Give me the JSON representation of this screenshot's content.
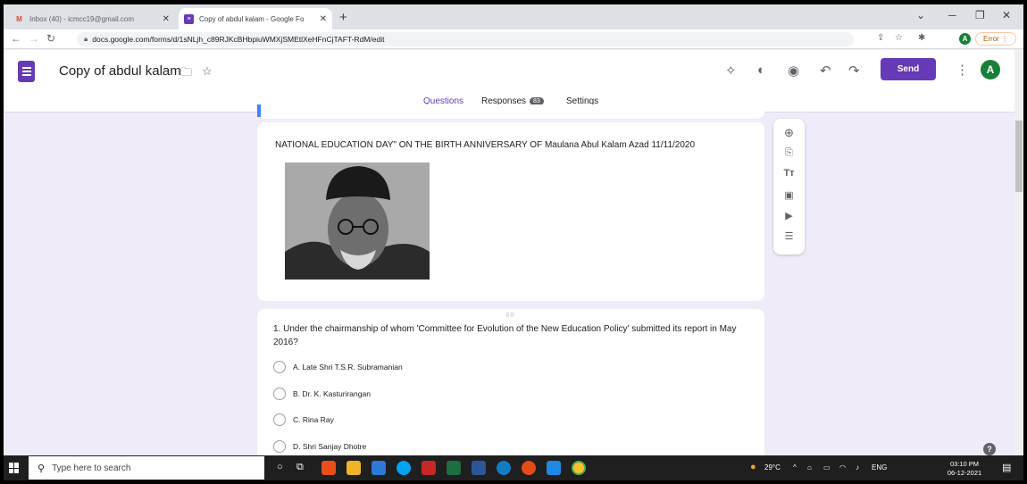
{
  "browser": {
    "tabs": [
      {
        "title": "Inbox (40) - icmcc19@gmail.com",
        "icon": "gmail-icon"
      },
      {
        "title": "Copy of abdul kalam - Google Fo",
        "icon": "forms-icon"
      }
    ],
    "url": "docs.google.com/forms/d/1sNLjh_c89RJKcBHbpiuWMXjSMEtlXeHFnCjTAFT-RdM/edit",
    "profile_initial": "A",
    "error_label": "Error"
  },
  "form": {
    "title": "Copy of abdul kalam",
    "send_label": "Send",
    "avatar_initial": "A",
    "tabs": {
      "questions": "Questions",
      "responses": "Responses",
      "responses_count": "83",
      "settings": "Settings"
    },
    "image_caption": "NATIONAL EDUCATION DAY\" ON  THE BIRTH ANNIVERSARY OF Maulana Abul Kalam Azad  11/11/2020",
    "question": {
      "text": "1. Under the chairmanship of whom 'Committee for Evolution of the New Education Policy' submitted its report in May 2016?",
      "options": [
        "A. Late Shri T.S.R. Subramanian",
        "B. Dr. K. Kasturirangan",
        "C. Rina Ray",
        "D. Shri Sanjay Dhotre"
      ]
    }
  },
  "taskbar": {
    "search_placeholder": "Type here to search",
    "weather": "29°C",
    "language": "ENG",
    "time": "03:10 PM",
    "date": "06-12-2021"
  },
  "colors": {
    "accent": "#673ab7",
    "background": "#f0ebf8"
  }
}
